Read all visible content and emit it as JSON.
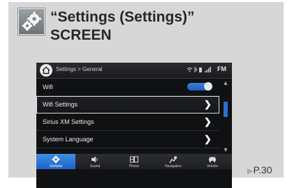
{
  "header": {
    "title_line1": "“Settings (Settings)”",
    "title_line2": "SCREEN",
    "icon": "gears-icon"
  },
  "screen": {
    "breadcrumb": "Settings > General",
    "status_icons": "wifi bluetooth battery signal",
    "band": "FM",
    "rows": [
      {
        "label": "Wifi",
        "control": "toggle",
        "toggle_on": true
      },
      {
        "label": "Wifi Settings",
        "control": "chevron",
        "selected": true
      },
      {
        "label": "Sirius XM Settings",
        "control": "chevron"
      },
      {
        "label": "System Language",
        "control": "chevron"
      }
    ],
    "chevron_glyph": "❯",
    "tabs": [
      {
        "label": "General",
        "icon": "gear-icon",
        "active": true
      },
      {
        "label": "Sound",
        "icon": "speaker-icon"
      },
      {
        "label": "Phone",
        "icon": "phone-icon"
      },
      {
        "label": "Navigation",
        "icon": "navigation-icon"
      },
      {
        "label": "Vehicle",
        "icon": "car-icon"
      }
    ],
    "colors": {
      "accent": "#2d6fd0",
      "background": "#101113"
    }
  },
  "page_reference": {
    "arrow": "▶",
    "label": "P.30"
  }
}
